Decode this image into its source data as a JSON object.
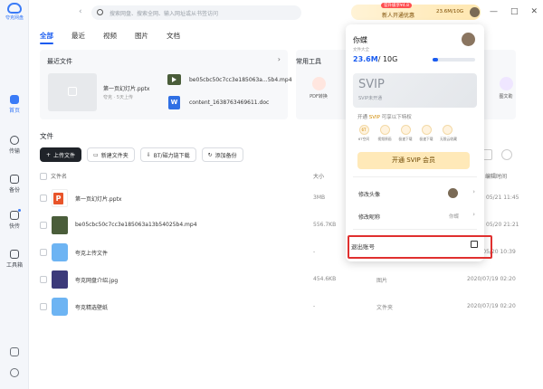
{
  "app": {
    "logo_text": "夸克网盘"
  },
  "sidebar": {
    "items": [
      {
        "label": "首页",
        "icon": "home-icon"
      },
      {
        "label": "传输",
        "icon": "transfer-icon"
      },
      {
        "label": "备份",
        "icon": "backup-icon"
      },
      {
        "label": "快传",
        "icon": "quick-transfer-icon"
      },
      {
        "label": "工具箱",
        "icon": "toolbox-icon"
      }
    ],
    "bottom_icons": [
      "phone-icon",
      "settings-icon"
    ]
  },
  "topbar": {
    "search_placeholder": "搜索网盘、搜索全网、输入网址或从书签访问",
    "promo_badge": "官升级享¥4.8",
    "promo_text": "新人开通优惠",
    "storage_mini": "23.6M/10G",
    "window_buttons": [
      "—",
      "□",
      "✕"
    ]
  },
  "tabs": [
    "全部",
    "最近",
    "视频",
    "图片",
    "文档"
  ],
  "recent": {
    "title": "最近文件",
    "files": [
      {
        "name": "第一页幻灯片.pptx",
        "sub": "夸克 · 5天上传"
      },
      {
        "name": "be05cbc50c7cc3e185063a...5b4.mp4"
      },
      {
        "name": "content_1638763469611.doc"
      }
    ]
  },
  "tools": {
    "title": "常用工具",
    "items": [
      {
        "label": "PDF转换"
      },
      {
        "label": "图文助"
      }
    ]
  },
  "files": {
    "title": "文件",
    "buttons": [
      "上传文件",
      "新建文件夹",
      "BT/磁力链下载",
      "添加备份"
    ],
    "columns": [
      "文件名",
      "大小",
      "",
      "编辑时间"
    ],
    "rows": [
      {
        "icon": "ppt",
        "name": "第一页幻灯片.pptx",
        "size": "3MB",
        "type": "",
        "time": "05/21 11:45"
      },
      {
        "icon": "mp4",
        "name": "be05cbc50c7cc3e185063a13b54025b4.mp4",
        "size": "556.7KB",
        "type": "",
        "time": "05/20 21:21"
      },
      {
        "icon": "folder",
        "name": "夸克上传文件",
        "size": "-",
        "type": "",
        "time": "2020/05/20 10:39"
      },
      {
        "icon": "jpg",
        "name": "夸克网盘介绍.jpg",
        "size": "454.6KB",
        "type": "图片",
        "time": "2020/07/19 02:20"
      },
      {
        "icon": "folder",
        "name": "夸克精选壁纸",
        "size": "-",
        "type": "文件夹",
        "time": "2020/07/19 02:20"
      }
    ]
  },
  "popup": {
    "username": "你蝶",
    "subtitle": "文件大全",
    "storage_used": "23.6M",
    "storage_total": "/ 10G",
    "storage_fraction": 0.13,
    "svip_title": "SVIP",
    "svip_subtitle": "SVIP未开通",
    "benefit_prefix": "开通",
    "benefit_svip": "SVIP",
    "benefit_suffix": "可享以下特权",
    "benefits": [
      "6T空间",
      "视频原画",
      "极速下载",
      "极速下载",
      "无限云收藏"
    ],
    "benefit_icons": [
      "6T"
    ],
    "svip_button": "开通 SVIP 会员",
    "menu": [
      {
        "label": "修改头像"
      },
      {
        "label": "修改昵称",
        "right": "你蝶"
      }
    ],
    "logout": "退出账号"
  }
}
